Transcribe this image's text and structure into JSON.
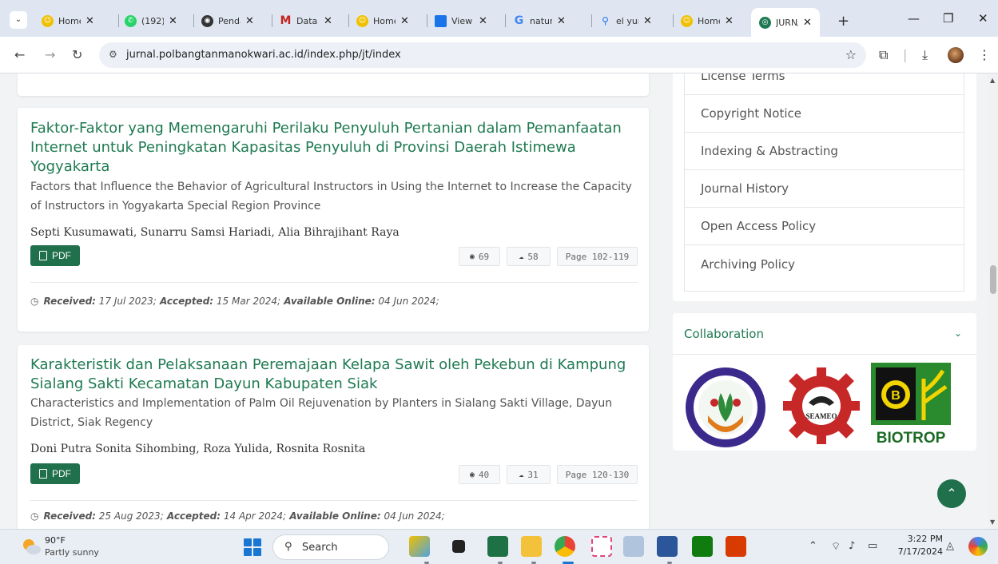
{
  "browser": {
    "menu_glyph": "⌄",
    "tabs": [
      {
        "label": "Home",
        "icon": "smiley-icon",
        "color": "#f0c000"
      },
      {
        "label": "(192)",
        "icon": "whatsapp-icon",
        "color": "#25d366"
      },
      {
        "label": "Penda",
        "icon": "globe-icon",
        "color": "#333333"
      },
      {
        "label": "Data",
        "icon": "gmail-icon",
        "color": "#c5221f"
      },
      {
        "label": "Home",
        "icon": "smiley-icon",
        "color": "#f0c000"
      },
      {
        "label": "View",
        "icon": "doc-icon",
        "color": "#1a73e8"
      },
      {
        "label": "natur",
        "icon": "google-icon",
        "color": "#4285f4"
      },
      {
        "label": "el yun",
        "icon": "search-icon",
        "color": "#1a73e8"
      },
      {
        "label": "Home",
        "icon": "smiley-icon",
        "color": "#f0c000"
      },
      {
        "label": "JURN/",
        "icon": "journal-icon",
        "color": "#1f7a53"
      }
    ],
    "close_glyph": "✕",
    "new_tab": "+",
    "url": "jurnal.polbangtanmanokwari.ac.id/index.php/jt/index"
  },
  "articles": [
    {
      "title": "Faktor-Faktor yang Memengaruhi Perilaku Penyuluh Pertanian dalam Pemanfaatan Internet untuk Peningkatan Kapasitas Penyuluh di Provinsi Daerah Istimewa Yogyakarta",
      "subtitle": "Factors that Influence the Behavior of Agricultural Instructors in Using the Internet to Increase the Capacity of Instructors in Yogyakarta Special Region Province",
      "authors": "Septi Kusumawati, Sunarru Samsi Hariadi, Alia Bihrajihant Raya",
      "pdf_label": "PDF",
      "views": "69",
      "downloads": "58",
      "pages": "Page 102-119",
      "received_label": "Received:",
      "received": " 17 Jul 2023;",
      "accepted_label": " Accepted:",
      "accepted": " 15 Mar 2024;",
      "online_label": " Available Online:",
      "online": " 04 Jun 2024;"
    },
    {
      "title": "Karakteristik dan Pelaksanaan Peremajaan Kelapa Sawit oleh Pekebun di Kampung Sialang Sakti Kecamatan Dayun Kabupaten Siak",
      "subtitle": "Characteristics and Implementation of Palm Oil Rejuvenation by Planters in Sialang Sakti Village, Dayun District, Siak Regency",
      "authors": "Doni Putra Sonita Sihombing, Roza Yulida, Rosnita Rosnita",
      "pdf_label": "PDF",
      "views": "40",
      "downloads": "31",
      "pages": "Page 120-130",
      "received_label": "Received:",
      "received": " 25 Aug 2023;",
      "accepted_label": " Accepted:",
      "accepted": " 14 Apr 2024;",
      "online_label": " Available Online:",
      "online": " 04 Jun 2024;"
    }
  ],
  "sidebar": {
    "items": [
      "License Terms",
      "Copyright Notice",
      "Indexing & Abstracting",
      "Journal History",
      "Open Access Policy",
      "Archiving Policy"
    ],
    "collab_title": "Collaboration",
    "seameo_text": "SEAMEO",
    "biotrop_text": "BIOTROP"
  },
  "taskbar": {
    "temperature": "90°F",
    "weather": "Partly sunny",
    "search": "Search",
    "time": "3:22 PM",
    "date": "7/17/2024"
  },
  "colors": {
    "accent": "#1f7a53",
    "button": "#20704b"
  }
}
